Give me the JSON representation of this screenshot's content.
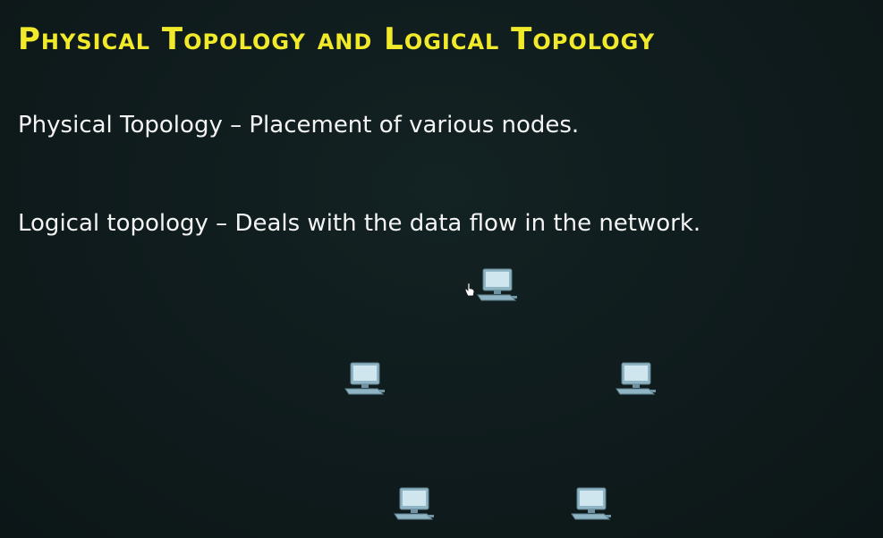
{
  "slide": {
    "title": "Physical Topology and Logical Topology",
    "lines": [
      "Physical Topology – Placement of various nodes.",
      "Logical topology – Deals with the data flow in the network."
    ]
  },
  "diagram": {
    "node_icon": "computer-icon",
    "node_count": 5,
    "colors": {
      "title": "#f1ea2a",
      "text": "#f4f4f4",
      "background": "#0f1b1c",
      "screen": "#cfe6ef",
      "body": "#8fb4c4"
    }
  }
}
